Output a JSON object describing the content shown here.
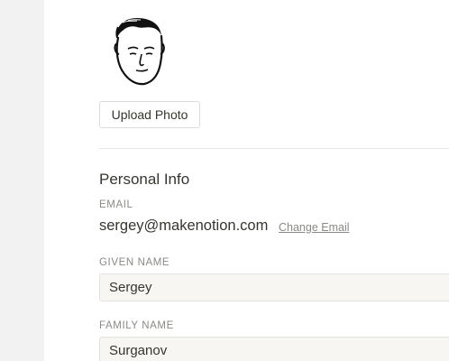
{
  "avatar": {
    "icon": "user-portrait-icon"
  },
  "upload_button": {
    "label": "Upload Photo"
  },
  "personal_info": {
    "title": "Personal Info",
    "email": {
      "label": "EMAIL",
      "value": "sergey@makenotion.com",
      "change_link": "Change Email"
    },
    "given_name": {
      "label": "GIVEN NAME",
      "value": "Sergey"
    },
    "family_name": {
      "label": "FAMILY NAME",
      "value": "Surganov"
    }
  },
  "colors": {
    "sidebar_bg": "#f2f2f2",
    "input_bg": "#f7f6f3",
    "text": "#37352f",
    "muted_text": "#8a8985"
  }
}
